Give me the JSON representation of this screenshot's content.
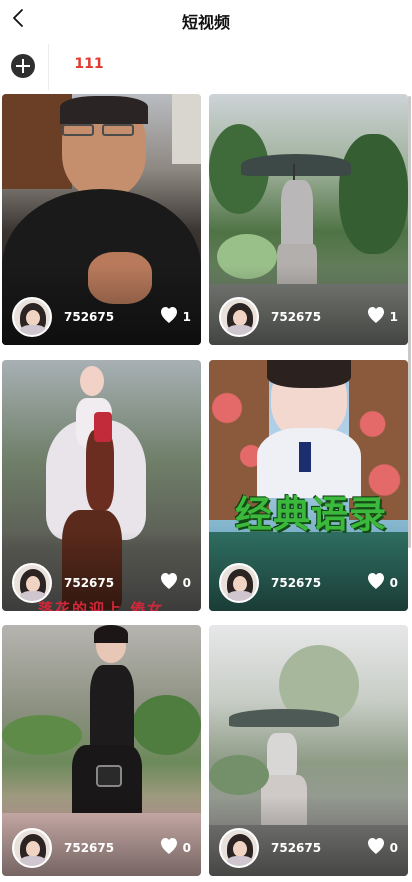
{
  "header": {
    "title": "短视频",
    "back_icon": "chevron-left-icon"
  },
  "tabs": {
    "add_icon": "plus-circle-icon",
    "items": [
      {
        "label": "111",
        "active": true
      }
    ]
  },
  "colors": {
    "active_tab": "#e03a2f",
    "overlay_green": "#3cb83c",
    "overlay_red": "#d2273a"
  },
  "videos": [
    {
      "username": "752675",
      "likes": "1",
      "icon": "heart-icon"
    },
    {
      "username": "752675",
      "likes": "1",
      "icon": "heart-icon"
    },
    {
      "username": "752675",
      "likes": "0",
      "icon": "heart-icon",
      "cut_text": "落花的迎上 傣女"
    },
    {
      "username": "752675",
      "likes": "0",
      "icon": "heart-icon",
      "overlay_text": "经典语录"
    },
    {
      "username": "752675",
      "likes": "0",
      "icon": "heart-icon"
    },
    {
      "username": "752675",
      "likes": "0",
      "icon": "heart-icon"
    }
  ]
}
